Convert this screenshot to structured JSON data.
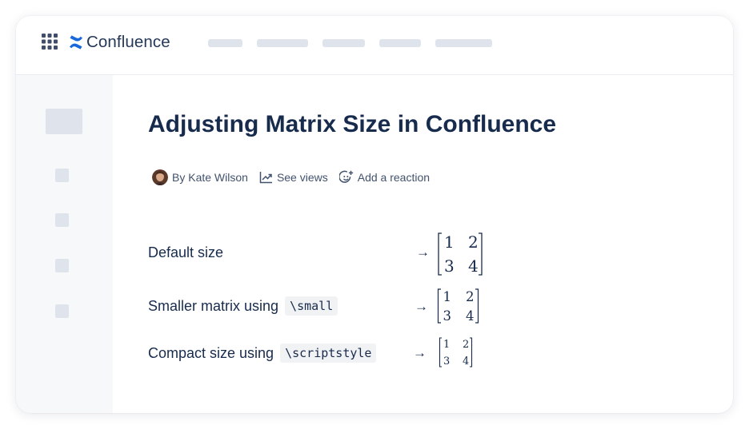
{
  "app": {
    "name": "Confluence"
  },
  "page": {
    "title": "Adjusting Matrix Size in Confluence",
    "byline": {
      "author": "By Kate Wilson",
      "views": "See views",
      "reaction": "Add a reaction"
    }
  },
  "rows": [
    {
      "label": "Default size",
      "code": "",
      "arrow": "→",
      "matrix": [
        [
          "1",
          "2"
        ],
        [
          "3",
          "4"
        ]
      ]
    },
    {
      "label": "Smaller matrix using",
      "code": "\\small",
      "arrow": "→",
      "matrix": [
        [
          "1",
          "2"
        ],
        [
          "3",
          "4"
        ]
      ]
    },
    {
      "label": "Compact size using",
      "code": "\\scriptstyle",
      "arrow": "→",
      "matrix": [
        [
          "1",
          "2"
        ],
        [
          "3",
          "4"
        ]
      ]
    }
  ],
  "colors": {
    "brand": "#1868db",
    "text": "#172b4d",
    "placeholder": "#dfe3ec"
  },
  "icons": [
    "apps-grid-icon",
    "confluence-logo-icon",
    "trend-chart-icon",
    "add-reaction-icon"
  ]
}
